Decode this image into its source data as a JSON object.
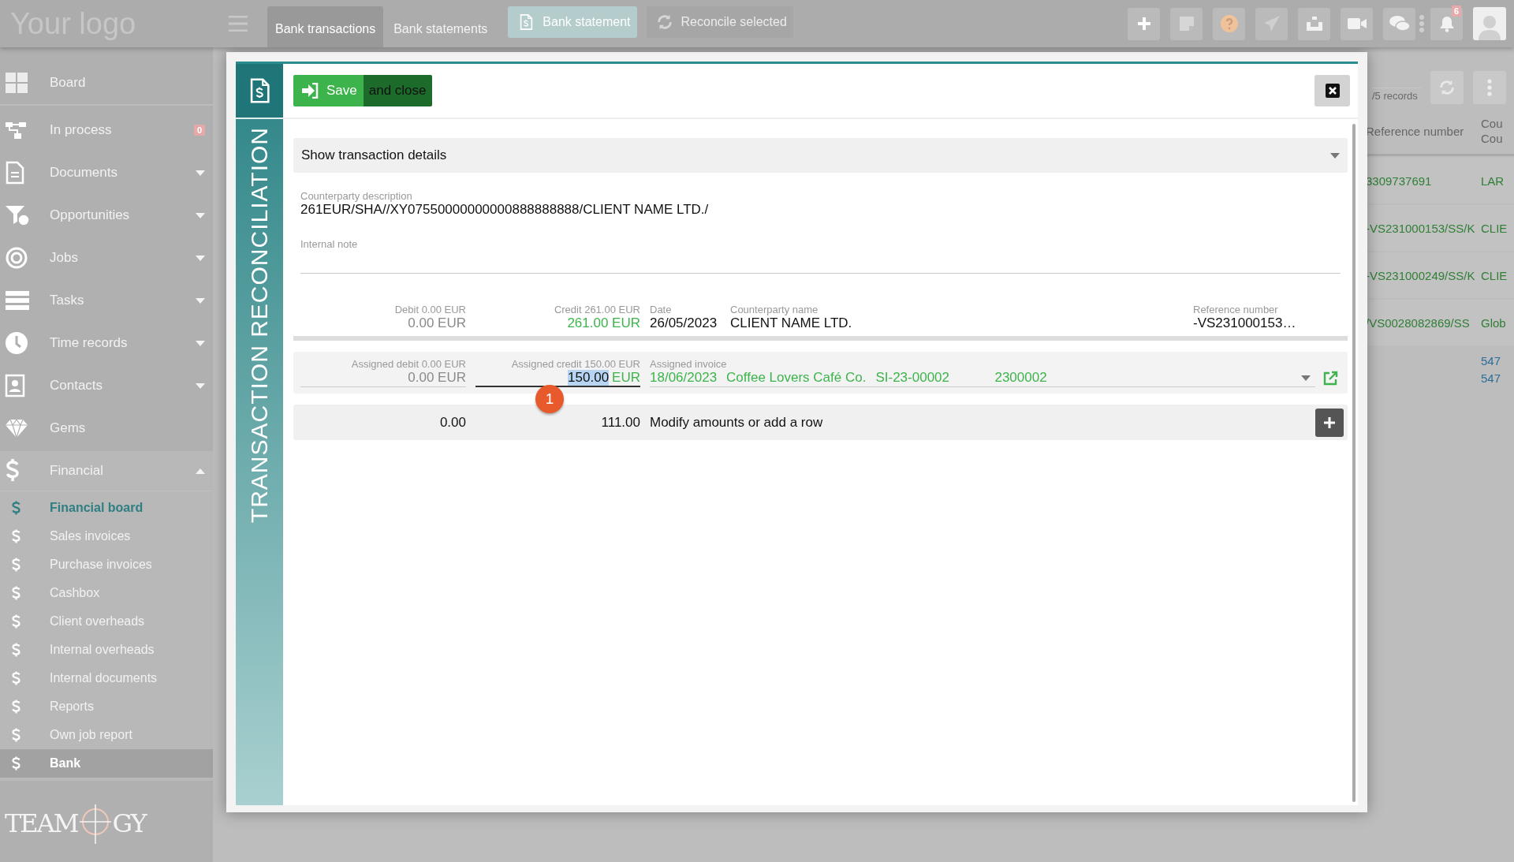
{
  "topbar": {
    "logo": "Your logo",
    "tabs": [
      {
        "label": "Bank transactions",
        "selected": true
      },
      {
        "label": "Bank statements",
        "selected": false
      }
    ],
    "actions": [
      {
        "label": "Bank statement",
        "disabled": false
      },
      {
        "label": "Reconcile selected",
        "disabled": true
      }
    ],
    "notification_count": "6"
  },
  "sidebar": {
    "items": [
      {
        "label": "Board"
      },
      {
        "label": "In process",
        "badge": "0"
      },
      {
        "label": "Documents",
        "expanded": false
      },
      {
        "label": "Opportunities",
        "expanded": false
      },
      {
        "label": "Jobs",
        "expanded": false
      },
      {
        "label": "Tasks",
        "expanded": false
      },
      {
        "label": "Time records",
        "expanded": false
      },
      {
        "label": "Contacts",
        "expanded": false
      },
      {
        "label": "Gems"
      },
      {
        "label": "Financial",
        "expanded": true,
        "children": [
          {
            "label": "Financial board",
            "highlighted": true,
            "selected": false
          },
          {
            "label": "Sales invoices",
            "highlighted": false,
            "selected": false
          },
          {
            "label": "Purchase invoices",
            "highlighted": false,
            "selected": false
          },
          {
            "label": "Cashbox",
            "highlighted": false,
            "selected": false
          },
          {
            "label": "Client overheads",
            "highlighted": false,
            "selected": false
          },
          {
            "label": "Internal overheads",
            "highlighted": false,
            "selected": false
          },
          {
            "label": "Internal documents",
            "highlighted": false,
            "selected": false
          },
          {
            "label": "Reports",
            "highlighted": false,
            "selected": false
          },
          {
            "label": "Own job report",
            "highlighted": false,
            "selected": false
          },
          {
            "label": "Bank",
            "highlighted": false,
            "selected": true
          }
        ]
      }
    ],
    "logo": {
      "left": "TEAM",
      "right": "GY"
    }
  },
  "background_table": {
    "records": "/5 records",
    "columns": [
      {
        "lines": [
          "Reference number"
        ]
      },
      {
        "lines": [
          "Cou",
          "Cou"
        ]
      }
    ],
    "rows": [
      {
        "kind": "text",
        "column_1": "3309737691",
        "column_2": [
          "LAR"
        ]
      },
      {
        "kind": "text",
        "column_1": "-VS231000153/SS/K",
        "column_2": [
          "CLIE"
        ]
      },
      {
        "kind": "text",
        "column_1": "-VS231000249/SS/K",
        "column_2": [
          "CLIE"
        ]
      },
      {
        "kind": "text",
        "column_1": "/VS0028082869/SS",
        "column_2": [
          "Glob"
        ]
      },
      {
        "kind": "link",
        "column_2": [
          "547",
          "547"
        ]
      }
    ]
  },
  "modal": {
    "side_title": "TRANSACTION RECONCILIATION",
    "save_label": "Save",
    "save_close_label": "and close",
    "details_toggle": {
      "label": "Show transaction details",
      "expanded": false
    },
    "counterparty_description": {
      "label": "Counterparty description",
      "value": "261EUR/SHA//XY07550000000000888888888/CLIENT NAME LTD./"
    },
    "internal_note": {
      "label": "Internal note"
    },
    "transaction": {
      "debit_label": "Debit 0.00 EUR",
      "debit": "0.00 EUR",
      "credit_label": "Credit 261.00 EUR",
      "credit": "261.00 EUR",
      "date_label": "Date",
      "date": "26/05/2023",
      "counterparty_label": "Counterparty name",
      "counterparty": "CLIENT NAME LTD.",
      "reference_label": "Reference number",
      "reference": "-VS231000153…"
    },
    "assignments": [
      {
        "debit_label": "Assigned debit 0.00 EUR",
        "debit": "0.00 EUR",
        "credit_label": "Assigned credit 150.00 EUR",
        "credit_amount": "150.00",
        "credit_selected": true,
        "credit_currency": "EUR",
        "invoice_label": "Assigned invoice",
        "invoice_date": "18/06/2023",
        "invoice_client": "Coffee Lovers Café Co.",
        "invoice_number": "SI-23-00002",
        "invoice_code": "2300002"
      }
    ],
    "step_marker": "1",
    "remainder": {
      "debit": "0.00",
      "credit": "111.00",
      "label": "Modify amounts or add a row"
    }
  }
}
